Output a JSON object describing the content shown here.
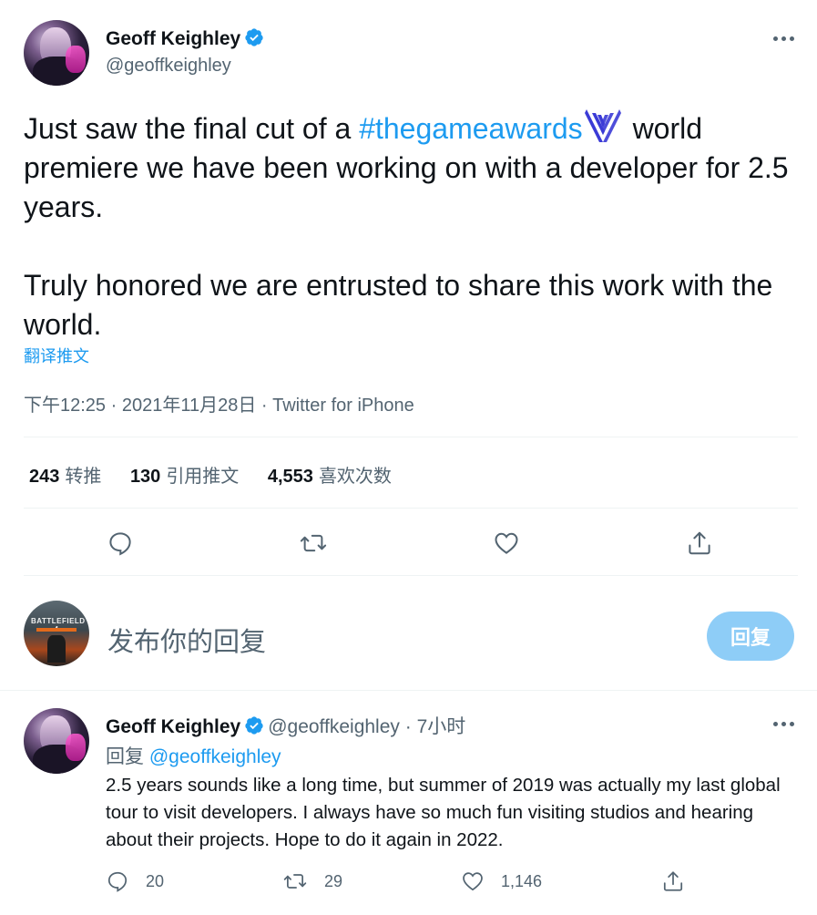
{
  "tweet": {
    "author_name": "Geoff Keighley",
    "author_handle": "@geoffkeighley",
    "text_part1": "Just saw the final cut of a ",
    "hashtag": "#thegameawards",
    "text_part2": " world premiere we have been working on with a developer for 2.5 years.",
    "text_para2": "Truly honored we are entrusted to share this work with the world.",
    "translate_label": "翻译推文",
    "time": "下午12:25",
    "date": "2021年11月28日",
    "source": "Twitter for iPhone",
    "separator": " · "
  },
  "stats": {
    "retweets_count": "243",
    "retweets_label": "转推",
    "quotes_count": "130",
    "quotes_label": "引用推文",
    "likes_count": "4,553",
    "likes_label": "喜欢次数"
  },
  "compose": {
    "placeholder": "发布你的回复",
    "reply_button": "回复",
    "avatar_text": "BATTLEFIELD 4"
  },
  "reply": {
    "author_name": "Geoff Keighley",
    "author_handle": "@geoffkeighley",
    "time_ago": "7小时",
    "replying_prefix": "回复",
    "replying_to": "@geoffkeighley",
    "text": "2.5 years sounds like a long time, but summer of 2019 was actually my last global tour to visit developers. I always have so much fun visiting studios and hearing about their projects. Hope to do it again in 2022.",
    "replies": "20",
    "retweets": "29",
    "likes": "1,146"
  },
  "colors": {
    "accent": "#1d9bf0",
    "secondary_text": "#536471",
    "primary_text": "#0f1419",
    "reply_button_bg": "#8ecdf7",
    "divider": "#eff3f4"
  },
  "icons": [
    "verified-badge-icon",
    "more-icon",
    "tga-emoji-icon",
    "reply-icon",
    "retweet-icon",
    "like-icon",
    "share-icon"
  ]
}
